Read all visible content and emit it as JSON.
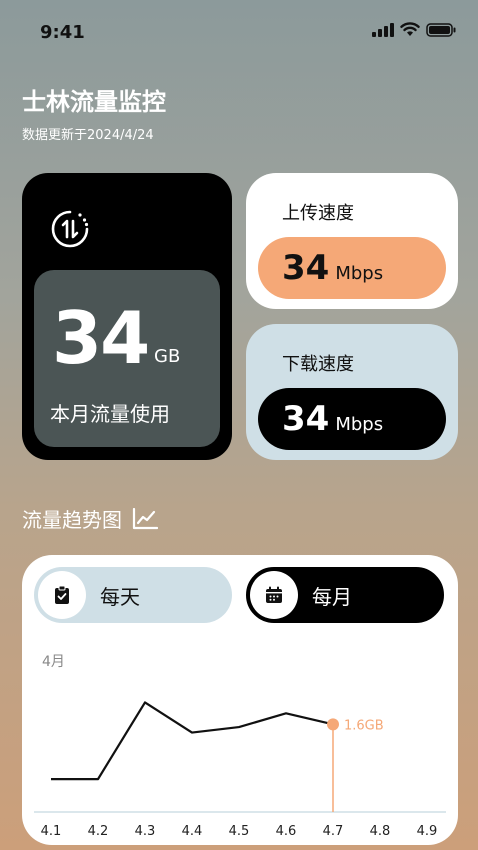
{
  "status": {
    "time": "9:41"
  },
  "header": {
    "title": "士林流量监控",
    "subtitle": "数据更新于2024/4/24"
  },
  "usage": {
    "value": "34",
    "unit": "GB",
    "label": "本月流量使用"
  },
  "upload": {
    "title": "上传速度",
    "value": "34",
    "unit": "Mbps"
  },
  "download": {
    "title": "下载速度",
    "value": "34",
    "unit": "Mbps"
  },
  "trend": {
    "title": "流量趋势图"
  },
  "toggles": {
    "day_label": "每天",
    "month_label": "每月"
  },
  "colors": {
    "accent_orange": "#f5a877",
    "pale_blue": "#cfdfe6",
    "dark_panel": "#4b5555"
  },
  "chart_data": {
    "type": "line",
    "period_label": "4月",
    "categories": [
      "4.1",
      "4.2",
      "4.3",
      "4.4",
      "4.5",
      "4.6",
      "4.7",
      "4.8",
      "4.9"
    ],
    "values": [
      0.6,
      0.6,
      2.0,
      1.45,
      1.55,
      1.8,
      1.6,
      null,
      null
    ],
    "highlight": {
      "index": 6,
      "label": "1.6GB"
    },
    "ylim": [
      0,
      2.5
    ],
    "grid": false
  }
}
